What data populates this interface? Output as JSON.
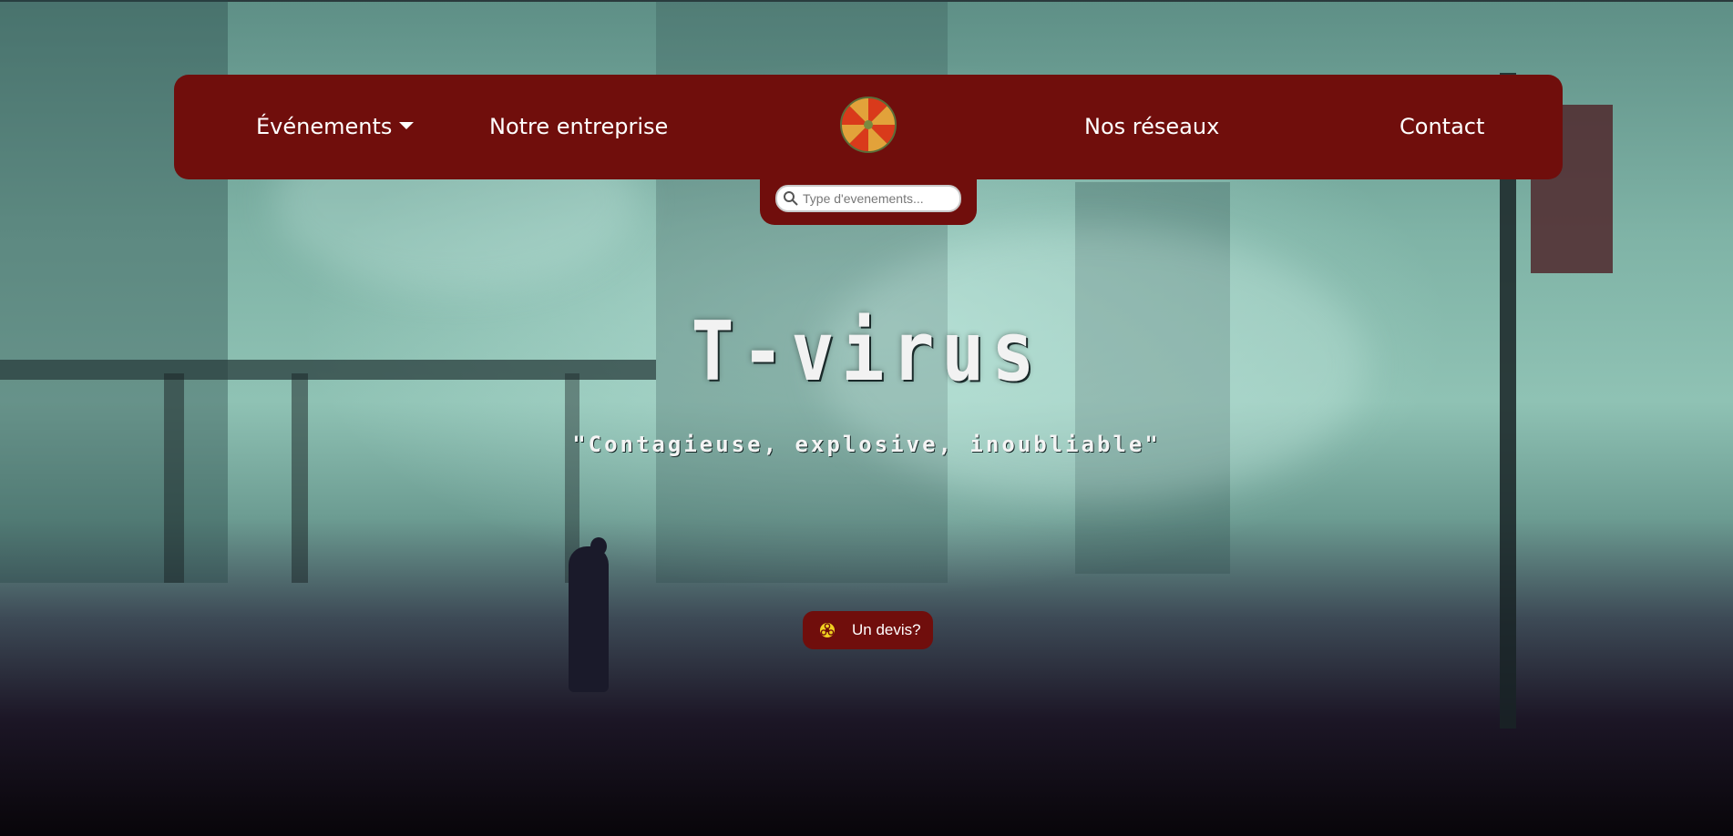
{
  "nav": {
    "events_label": "Événements",
    "company_label": "Notre entreprise",
    "networks_label": "Nos réseaux",
    "contact_label": "Contact",
    "logo_icon": "umbrella-logo-icon"
  },
  "search": {
    "placeholder": "Type d'evenements...",
    "value": ""
  },
  "hero": {
    "title": "T-virus",
    "tagline": "\"Contagieuse, explosive, inoubliable\""
  },
  "cta": {
    "label": "Un devis?",
    "icon": "biohazard-icon"
  },
  "colors": {
    "brand": "#700e0c",
    "text": "#ffffff"
  }
}
